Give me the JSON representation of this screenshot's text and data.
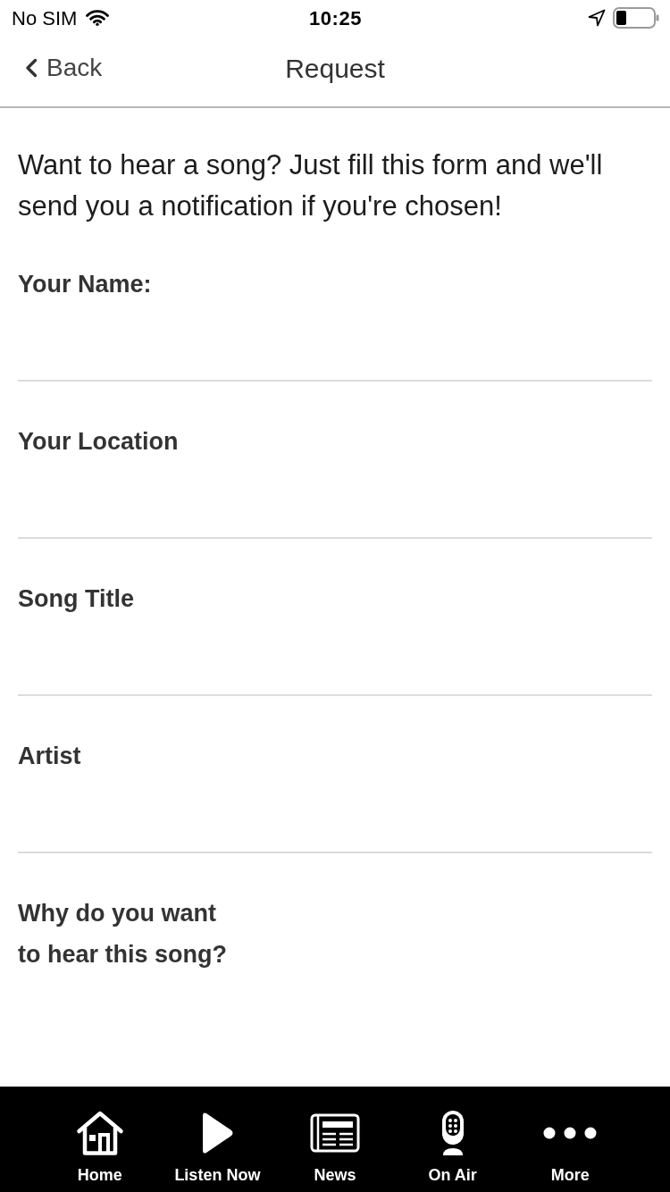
{
  "status_bar": {
    "carrier": "No SIM",
    "time": "10:25"
  },
  "nav_bar": {
    "back": "Back",
    "title": "Request"
  },
  "intro": "Want to hear a song? Just fill this form and we'll send you a notification if you're chosen!",
  "fields": [
    {
      "label": "Your Name:",
      "kind": "line"
    },
    {
      "label": "Your Location",
      "kind": "line"
    },
    {
      "label": "Song Title",
      "kind": "line"
    },
    {
      "label": "Artist",
      "kind": "line"
    },
    {
      "label": "Why do you want to hear this song?",
      "kind": "open"
    }
  ],
  "tab_bar": [
    {
      "label": "Home",
      "kind": "home"
    },
    {
      "label": "Listen Now",
      "kind": "play"
    },
    {
      "label": "News",
      "kind": "news"
    },
    {
      "label": "On Air",
      "kind": "onair"
    },
    {
      "label": "More",
      "kind": "more"
    }
  ]
}
